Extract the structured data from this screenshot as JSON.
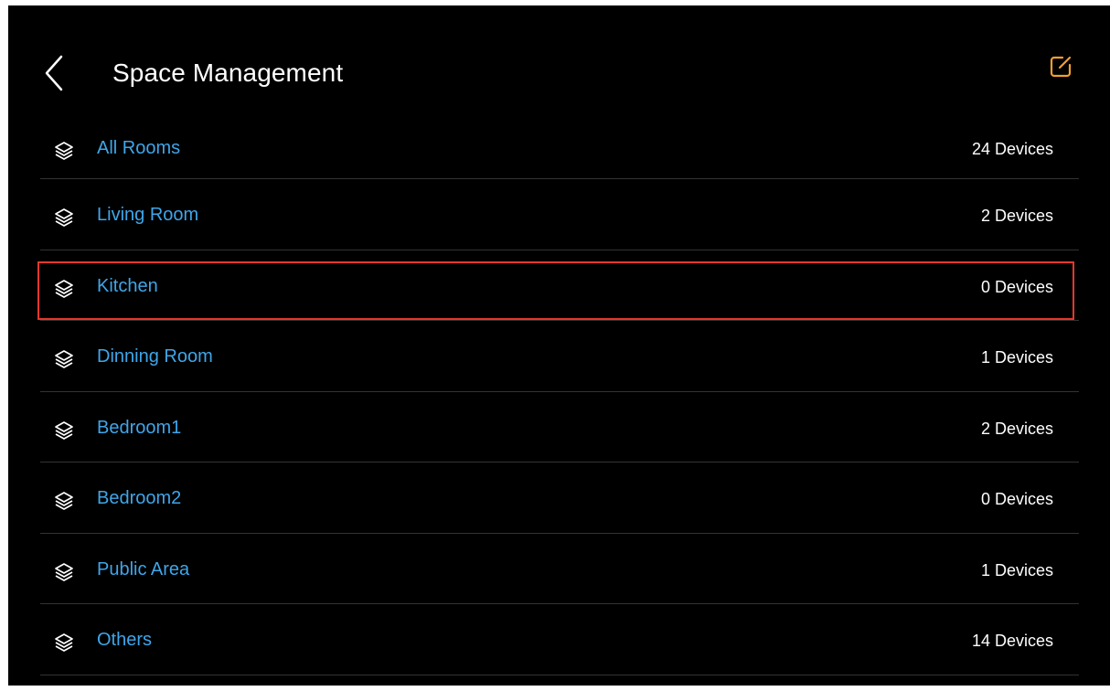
{
  "header": {
    "title": "Space Management",
    "back_icon": "chevron-left-icon",
    "edit_icon": "edit-icon",
    "accent_color": "#f0a030"
  },
  "rooms": [
    {
      "name": "All Rooms",
      "count": "24 Devices"
    },
    {
      "name": "Living Room",
      "count": "2 Devices"
    },
    {
      "name": "Kitchen",
      "count": "0 Devices",
      "selected": true
    },
    {
      "name": "Dinning Room",
      "count": "1 Devices"
    },
    {
      "name": "Bedroom1",
      "count": "2 Devices"
    },
    {
      "name": "Bedroom2",
      "count": "0 Devices"
    },
    {
      "name": "Public Area",
      "count": "1 Devices"
    },
    {
      "name": "Others",
      "count": "14 Devices"
    }
  ],
  "colors": {
    "background": "#000000",
    "room_name": "#3fa6ea",
    "count_text": "#ffffff",
    "divider": "#333333",
    "selection_border": "#e5382c"
  }
}
